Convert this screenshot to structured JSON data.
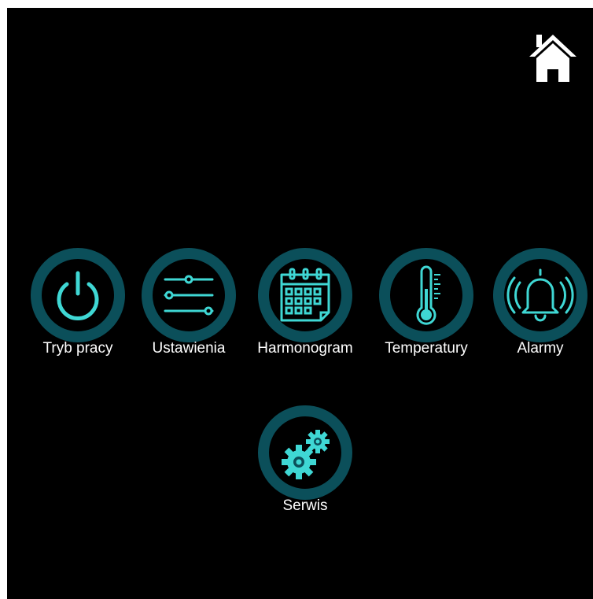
{
  "colors": {
    "background": "#000000",
    "ring": "#0b4f5a",
    "icon": "#3fd7d4",
    "label": "#ffffff",
    "home_icon": "#ffffff"
  },
  "header": {
    "home_icon": "home-icon"
  },
  "menu": {
    "items": [
      {
        "label": "Tryb pracy",
        "icon": "power-icon"
      },
      {
        "label": "Ustawienia",
        "icon": "sliders-icon"
      },
      {
        "label": "Harmonogram",
        "icon": "calendar-icon"
      },
      {
        "label": "Temperatury",
        "icon": "thermometer-icon"
      },
      {
        "label": "Alarmy",
        "icon": "bell-icon"
      },
      {
        "label": "Serwis",
        "icon": "gears-icon"
      }
    ]
  }
}
